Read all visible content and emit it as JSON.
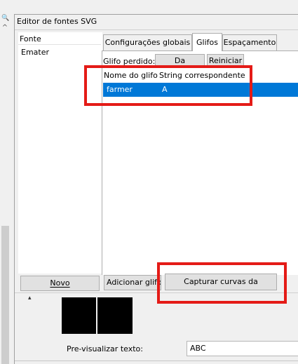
{
  "left_strip": {
    "zoom_glyph": "🔍",
    "up_glyph": "^"
  },
  "panel": {
    "title": "Editor de fontes SVG"
  },
  "font_list": {
    "header": "Fonte",
    "items": [
      "Emater"
    ],
    "new_button": "Novo"
  },
  "tabs": [
    {
      "label": "Configurações globais"
    },
    {
      "label": "Glifos",
      "active": true
    },
    {
      "label": "Espaçamento"
    }
  ],
  "glyphs": {
    "missing_glyph_label": "Glifo perdido:",
    "from_selection_button": "Da seleção...",
    "reset_button": "Reiniciar",
    "columns": [
      "Nome do glifo",
      "String correspondente"
    ],
    "rows": [
      {
        "name": "farmer",
        "string": "A",
        "selected": true
      }
    ],
    "add_glyph_button": "Adicionar glifo",
    "capture_button": "Capturar curvas da seleção..."
  },
  "preview": {
    "label": "Pre-visualizar texto:",
    "text_value": "ABC"
  },
  "colors": {
    "selection": "#0078d7",
    "annotation_red": "#e41b17",
    "background": "#f0f0f0"
  }
}
